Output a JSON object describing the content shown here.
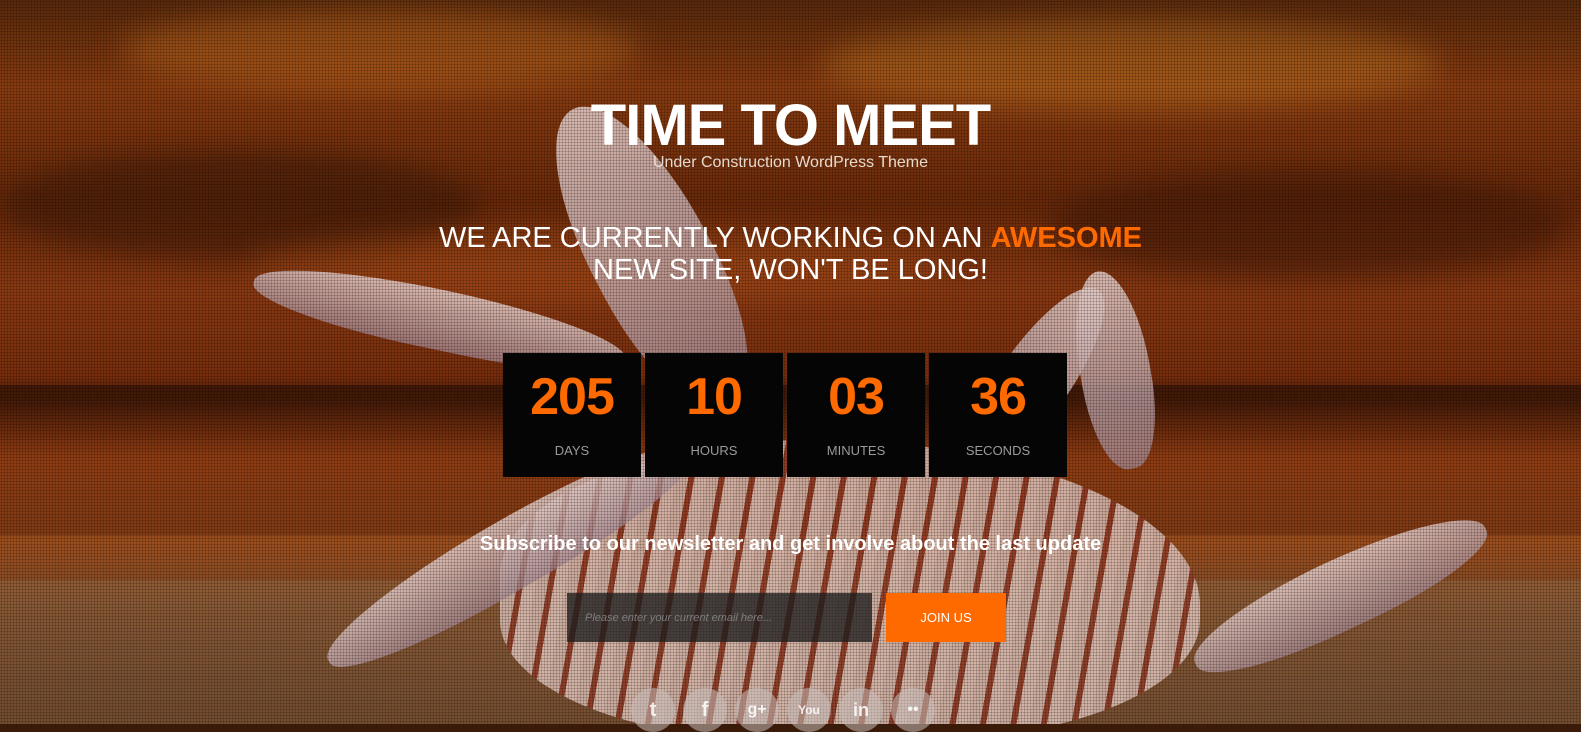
{
  "header": {
    "title": "TIME TO MEET",
    "subtitle": "Under Construction WordPress Theme"
  },
  "headline": {
    "part1": "WE ARE CURRENTLY WORKING ON AN ",
    "accent": "AWESOME",
    "part2": "NEW SITE, WON'T BE LONG!"
  },
  "countdown": [
    {
      "value": "205",
      "label": "DAYS"
    },
    {
      "value": "10",
      "label": "HOURS"
    },
    {
      "value": "03",
      "label": "MINUTES"
    },
    {
      "value": "36",
      "label": "SECONDS"
    }
  ],
  "newsletter": {
    "text": "Subscribe to our newsletter and get involve about the last update",
    "email_placeholder": "Please enter your current email here...",
    "button_label": "JOIN US"
  },
  "social": [
    {
      "icon": "twitter-icon",
      "glyph": "t"
    },
    {
      "icon": "facebook-icon",
      "glyph": "f"
    },
    {
      "icon": "google-plus-icon",
      "glyph": "g+"
    },
    {
      "icon": "youtube-icon",
      "glyph": "You"
    },
    {
      "icon": "linkedin-icon",
      "glyph": "in"
    },
    {
      "icon": "flickr-icon",
      "glyph": "••"
    }
  ],
  "colors": {
    "accent": "#ff6a00",
    "countdown_bg": "#050505"
  }
}
